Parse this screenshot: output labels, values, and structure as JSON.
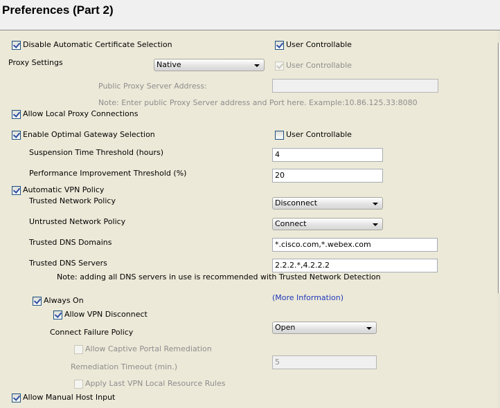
{
  "header": {
    "title": "Preferences (Part 2)"
  },
  "settings": {
    "disable_auto_cert": {
      "label": "Disable Automatic Certificate Selection",
      "checked": true
    },
    "disable_auto_cert_uc": {
      "label": "User Controllable",
      "checked": true
    },
    "proxy_settings": {
      "label": "Proxy Settings",
      "value": "Native"
    },
    "proxy_uc": {
      "label": "User Controllable",
      "checked": true,
      "disabled": true
    },
    "public_proxy": {
      "label": "Public Proxy Server Address:",
      "value": ""
    },
    "proxy_note": "Note: Enter public Proxy Server address and Port here. Example:10.86.125.33:8080",
    "allow_local_proxy": {
      "label": "Allow Local Proxy Connections",
      "checked": true
    },
    "optimal_gateway": {
      "label": "Enable Optimal Gateway Selection",
      "checked": true
    },
    "optimal_gateway_uc": {
      "label": "User Controllable",
      "checked": false
    },
    "suspension_time": {
      "label": "Suspension Time Threshold (hours)",
      "value": "4"
    },
    "perf_threshold": {
      "label": "Performance Improvement Threshold (%)",
      "value": "20"
    },
    "auto_vpn_policy": {
      "label": "Automatic VPN Policy",
      "checked": true
    },
    "trusted_network_policy": {
      "label": "Trusted Network Policy",
      "value": "Disconnect"
    },
    "untrusted_network_policy": {
      "label": "Untrusted Network Policy",
      "value": "Connect"
    },
    "trusted_dns_domains": {
      "label": "Trusted DNS Domains",
      "value": "*.cisco.com,*.webex.com"
    },
    "trusted_dns_servers": {
      "label": "Trusted DNS Servers",
      "value": "2.2.2.*,4.2.2.2"
    },
    "dns_note": "Note: adding all DNS servers in use is recommended with Trusted Network Detection",
    "always_on": {
      "label": "Always On",
      "checked": true
    },
    "more_info": "(More Information)",
    "allow_vpn_disconnect": {
      "label": "Allow VPN Disconnect",
      "checked": true
    },
    "connect_failure_policy": {
      "label": "Connect Failure Policy",
      "value": "Open"
    },
    "captive_portal": {
      "label": "Allow Captive Portal Remediation",
      "checked": false,
      "disabled": true
    },
    "remediation_timeout": {
      "label": "Remediation Timeout (min.)",
      "value": "5",
      "disabled": true
    },
    "apply_last_vpn": {
      "label": "Apply Last VPN Local Resource Rules",
      "checked": false,
      "disabled": true
    },
    "allow_manual_host": {
      "label": "Allow Manual Host Input",
      "checked": true
    }
  }
}
